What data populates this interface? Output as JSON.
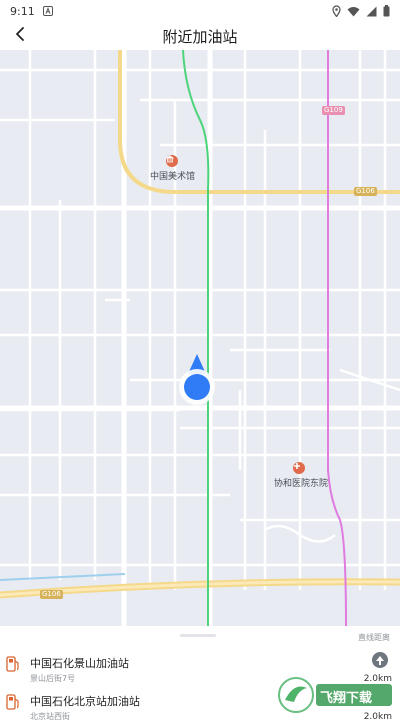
{
  "status_bar": {
    "time": "9:11",
    "icons": [
      "notification-a-icon",
      "location-icon",
      "wifi-icon",
      "signal-icon",
      "battery-icon"
    ]
  },
  "header": {
    "title": "附近加油站",
    "back_icon": "chevron-left-icon"
  },
  "map": {
    "labels": {
      "museum": "中国美术馆",
      "hospital": "协和医院东院"
    },
    "road_badges": {
      "top_right": "G109",
      "right": "G106",
      "bottom_left": "G106"
    },
    "colors": {
      "background": "#e8ebf1",
      "road": "#ffffff",
      "ring_road": "#f5d98a",
      "green_line": "#4cd47a",
      "pink_line": "#e07be0",
      "water": "#9ed0ee",
      "marker": "#2f7cf6"
    }
  },
  "panel": {
    "note": "直线距离",
    "stations": [
      {
        "name": "中国石化景山加油站",
        "address": "景山后街7号",
        "distance": "2.0km"
      },
      {
        "name": "中国石化北京站加油站",
        "address": "北京站西街",
        "distance": "2.0km"
      }
    ]
  },
  "watermark": {
    "text": "飞翔下载"
  }
}
